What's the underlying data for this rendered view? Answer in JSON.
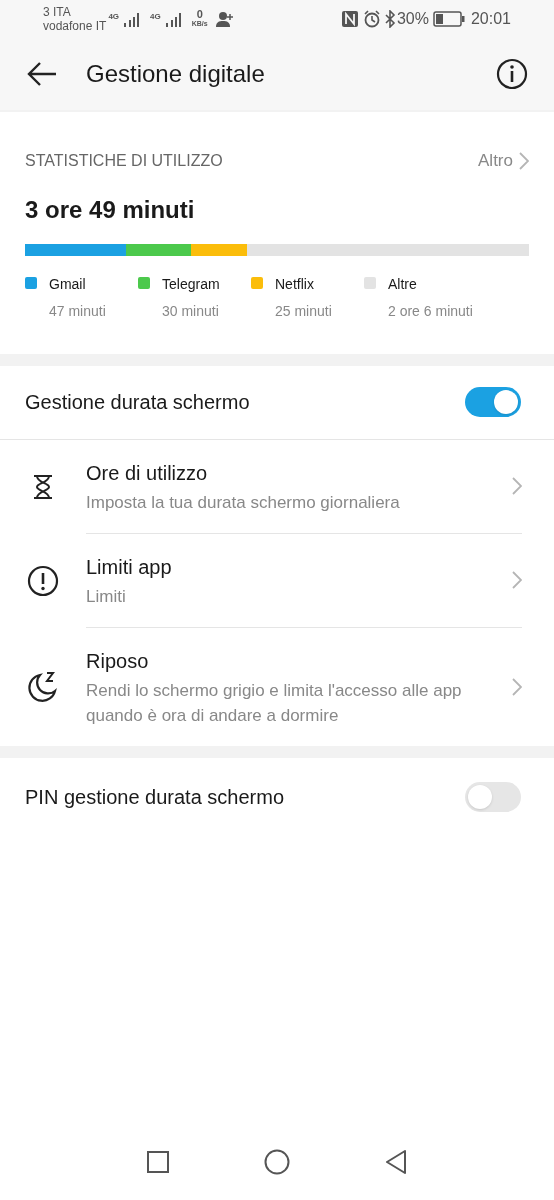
{
  "status_bar": {
    "carrier_1": "3 ITA",
    "carrier_2": "vodafone IT",
    "network_1": "4G",
    "network_2": "4G",
    "speed_value": "0",
    "speed_unit": "KB/s",
    "battery": "30%",
    "time": "20:01"
  },
  "header": {
    "title": "Gestione digitale"
  },
  "usage": {
    "heading": "STATISTICHE DI UTILIZZO",
    "more": "Altro",
    "total": "3 ore 49 minuti",
    "apps": [
      {
        "name": "Gmail",
        "time": "47 minuti",
        "color": "#1ba1e2"
      },
      {
        "name": "Telegram",
        "time": "30 minuti",
        "color": "#4cc94c"
      },
      {
        "name": "Netflix",
        "time": "25 minuti",
        "color": "#fbbd0b"
      },
      {
        "name": "Altre",
        "time": "2 ore 6 minuti",
        "color": "#e3e3e3"
      }
    ]
  },
  "screen_time": {
    "label": "Gestione durata schermo",
    "on": true,
    "items": [
      {
        "kind": "hourglass",
        "title": "Ore di utilizzo",
        "subtitle": "Imposta la tua durata schermo giornaliera"
      },
      {
        "kind": "alert",
        "title": "Limiti app",
        "subtitle": "Limiti"
      },
      {
        "kind": "moon",
        "title": "Riposo",
        "subtitle": "Rendi lo schermo grigio e limita l'accesso alle app quando è ora di andare a dormire"
      }
    ]
  },
  "pin": {
    "label": "PIN gestione durata schermo",
    "on": false
  }
}
